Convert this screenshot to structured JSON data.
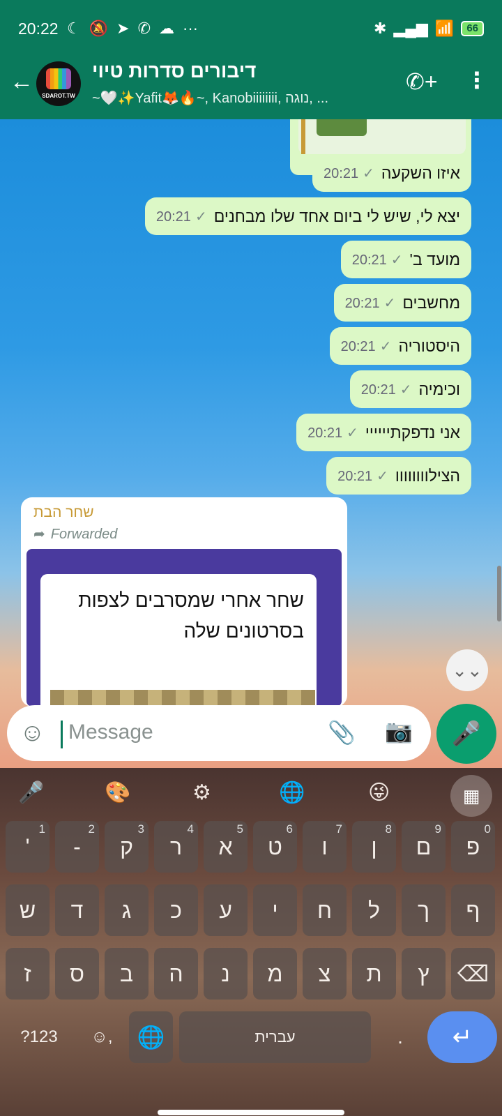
{
  "status_bar": {
    "time": "20:22",
    "left_icons": [
      "☾",
      "🔕",
      "➤",
      "✆",
      "☁",
      "···"
    ],
    "right_icons": [
      "✱",
      "▂▄▆",
      "📶"
    ],
    "battery": "66"
  },
  "header": {
    "title": "דיבורים סדרות טיוי",
    "subtitle": "~🤍✨Yafit🦊🔥~, Kanobiiiiiiii, נוגה, ...",
    "avatar_text": "SDAROT.TW"
  },
  "messages": [
    {
      "text": "איזו השקעה",
      "time": "20:21"
    },
    {
      "text": "יצא לי, שיש לי ביום אחד שלו מבחנים",
      "time": "20:21"
    },
    {
      "text": "מועד ב'",
      "time": "20:21"
    },
    {
      "text": "מחשבים",
      "time": "20:21"
    },
    {
      "text": "היסטוריה",
      "time": "20:21"
    },
    {
      "text": "וכימיה",
      "time": "20:21"
    },
    {
      "text": "אני נדפקתיייייי",
      "time": "20:21"
    },
    {
      "text": "הצילוווווווו",
      "time": "20:21"
    }
  ],
  "incoming": {
    "sender": "שחר הבת",
    "forwarded_label": "Forwarded",
    "card_caption": "שחר אחרי שמסרבים לצפות בסרטונים שלה"
  },
  "input": {
    "placeholder": "Message"
  },
  "keyboard": {
    "row1": [
      [
        "'",
        "1"
      ],
      [
        "-",
        "2"
      ],
      [
        "ק",
        "3"
      ],
      [
        "ר",
        "4"
      ],
      [
        "א",
        "5"
      ],
      [
        "ט",
        "6"
      ],
      [
        "ו",
        "7"
      ],
      [
        "ן",
        "8"
      ],
      [
        "ם",
        "9"
      ],
      [
        "פ",
        "0"
      ]
    ],
    "row2": [
      "ש",
      "ד",
      "ג",
      "כ",
      "ע",
      "י",
      "ח",
      "ל",
      "ך",
      "ף"
    ],
    "row3": [
      "ז",
      "ס",
      "ב",
      "ה",
      "נ",
      "מ",
      "צ",
      "ת",
      "ץ"
    ],
    "symbols_label": "?123",
    "space_label": "עברית",
    "period": "."
  }
}
